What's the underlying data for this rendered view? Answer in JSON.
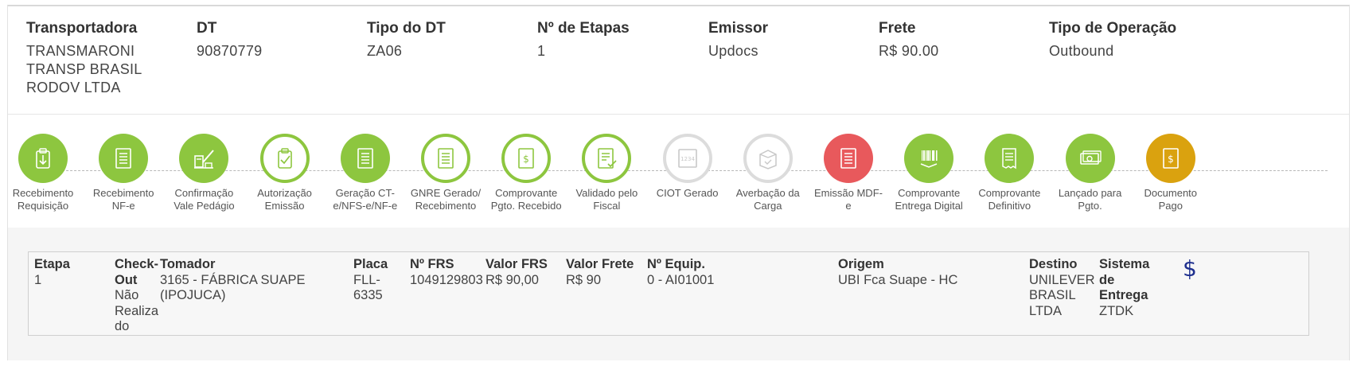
{
  "header": {
    "transportadora": {
      "label": "Transportadora",
      "value": "TRANSMARONI TRANSP BRASIL RODOV LTDA"
    },
    "dt": {
      "label": "DT",
      "value": "90870779"
    },
    "tipo_dt": {
      "label": "Tipo do DT",
      "value": "ZA06"
    },
    "etapas": {
      "label": "Nº de Etapas",
      "value": "1"
    },
    "emissor": {
      "label": "Emissor",
      "value": "Updocs"
    },
    "frete": {
      "label": "Frete",
      "value": "R$ 90.00"
    },
    "operacao": {
      "label": "Tipo de Operação",
      "value": "Outbound"
    }
  },
  "steps": [
    {
      "l1": "Recebimento",
      "l2": "Requisição",
      "icon": "download-doc-icon",
      "state": "done"
    },
    {
      "l1": "Recebimento",
      "l2": "NF-e",
      "icon": "document-icon",
      "state": "done"
    },
    {
      "l1": "Confirmação",
      "l2": "Vale Pedágio",
      "icon": "toll-gate-icon",
      "state": "done"
    },
    {
      "l1": "Autorização",
      "l2": "Emissão",
      "icon": "clipboard-check-icon",
      "state": "current"
    },
    {
      "l1": "Geração CT-",
      "l2": "e/NFS-e/NF-e",
      "icon": "document-icon",
      "state": "done"
    },
    {
      "l1": "GNRE Gerado/",
      "l2": "Recebimento",
      "icon": "document-icon",
      "state": "current"
    },
    {
      "l1": "Comprovante",
      "l2": "Pgto. Recebido",
      "icon": "money-doc-icon",
      "state": "current"
    },
    {
      "l1": "Validado pelo",
      "l2": "Fiscal",
      "icon": "doc-check-icon",
      "state": "current"
    },
    {
      "l1": "CIOT Gerado",
      "l2": "",
      "icon": "ciot-icon",
      "state": "pending"
    },
    {
      "l1": "Averbação da",
      "l2": "Carga",
      "icon": "box-check-icon",
      "state": "pending"
    },
    {
      "l1": "Emissão MDF-",
      "l2": "e",
      "icon": "document-icon",
      "state": "error"
    },
    {
      "l1": "Comprovante",
      "l2": "Entrega Digital",
      "icon": "barcode-icon",
      "state": "done"
    },
    {
      "l1": "Comprovante",
      "l2": "Definitivo",
      "icon": "receipt-icon",
      "state": "done"
    },
    {
      "l1": "Lançado para",
      "l2": "Pgto.",
      "icon": "cash-icon",
      "state": "done"
    },
    {
      "l1": "Documento",
      "l2": "Pago",
      "icon": "money-doc-icon",
      "state": "paid"
    }
  ],
  "table": {
    "etapa": {
      "label": "Etapa",
      "value": "1"
    },
    "checkout": {
      "label1": "Check-",
      "label2": "Out",
      "value_lines": [
        "Não",
        "Realiza",
        "do"
      ]
    },
    "tomador": {
      "label": "Tomador",
      "value_lines": [
        "3165 - FÁBRICA SUAPE",
        "(IPOJUCA)"
      ]
    },
    "placa": {
      "label": "Placa",
      "value_lines": [
        "FLL-",
        "6335"
      ]
    },
    "nfrs": {
      "label": "Nº FRS",
      "value": "1049129803"
    },
    "valor_frs": {
      "label": "Valor FRS",
      "value": "R$ 90,00"
    },
    "valor_frete": {
      "label": "Valor Frete",
      "value": "R$ 90"
    },
    "equip": {
      "label": "Nº Equip.",
      "value": "0 - AI01001"
    },
    "origem": {
      "label": "Origem",
      "value": "UBI Fca Suape - HC"
    },
    "destino": {
      "label": "Destino",
      "value_lines": [
        "UNILEVER",
        "BRASIL",
        "LTDA"
      ]
    },
    "sistema": {
      "label_lines": [
        "Sistema",
        "de",
        "Entrega"
      ],
      "value": "ZTDK"
    },
    "dollar_icon": "$"
  },
  "colors": {
    "green": "#8dc63f",
    "red": "#e8595c",
    "gold": "#daa20f",
    "grey": "#dcdcdc",
    "dollar": "#1e2f8e"
  }
}
